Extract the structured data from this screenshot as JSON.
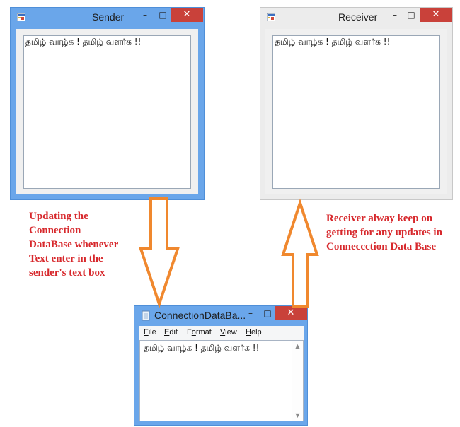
{
  "sender": {
    "title": "Sender",
    "minimize": "–",
    "maximize": "□",
    "close": "✕",
    "text_value": "தமிழ் வாழ்க ! தமிழ் வளர்க !!"
  },
  "receiver": {
    "title": "Receiver",
    "minimize": "–",
    "maximize": "□",
    "close": "✕",
    "text_value": "தமிழ் வாழ்க ! தமிழ் வளர்க !!"
  },
  "notepad": {
    "title": "ConnectionDataBa...",
    "minimize": "–",
    "maximize": "□",
    "close": "✕",
    "menu": [
      {
        "accel": "F",
        "rest": "ile"
      },
      {
        "accel": "E",
        "rest": "dit"
      },
      {
        "accel": "",
        "rest": "Format",
        "underline_index": 1
      },
      {
        "accel": "V",
        "rest": "iew"
      },
      {
        "accel": "H",
        "rest": "elp"
      }
    ],
    "content": "தமிழ் வாழ்க ! தமிழ் வளர்க !!",
    "scroll_up": "▲",
    "scroll_down": "▼"
  },
  "captions": {
    "left": [
      "Updating the",
      "Connection",
      "DataBase whenever",
      "Text enter in the",
      "sender's text box"
    ],
    "right": [
      "Receiver alway keep on",
      "getting for any updates in",
      "Conneccction Data Base"
    ]
  },
  "colors": {
    "arrow_fill": "#ffffff",
    "arrow_stroke": "#f0882e",
    "caption": "#d7282c",
    "active_frame": "#6aa6ea",
    "close_button": "#c9413a"
  },
  "icons": {
    "form_icon": "winforms-app-icon",
    "notepad_icon": "notepad-icon"
  }
}
